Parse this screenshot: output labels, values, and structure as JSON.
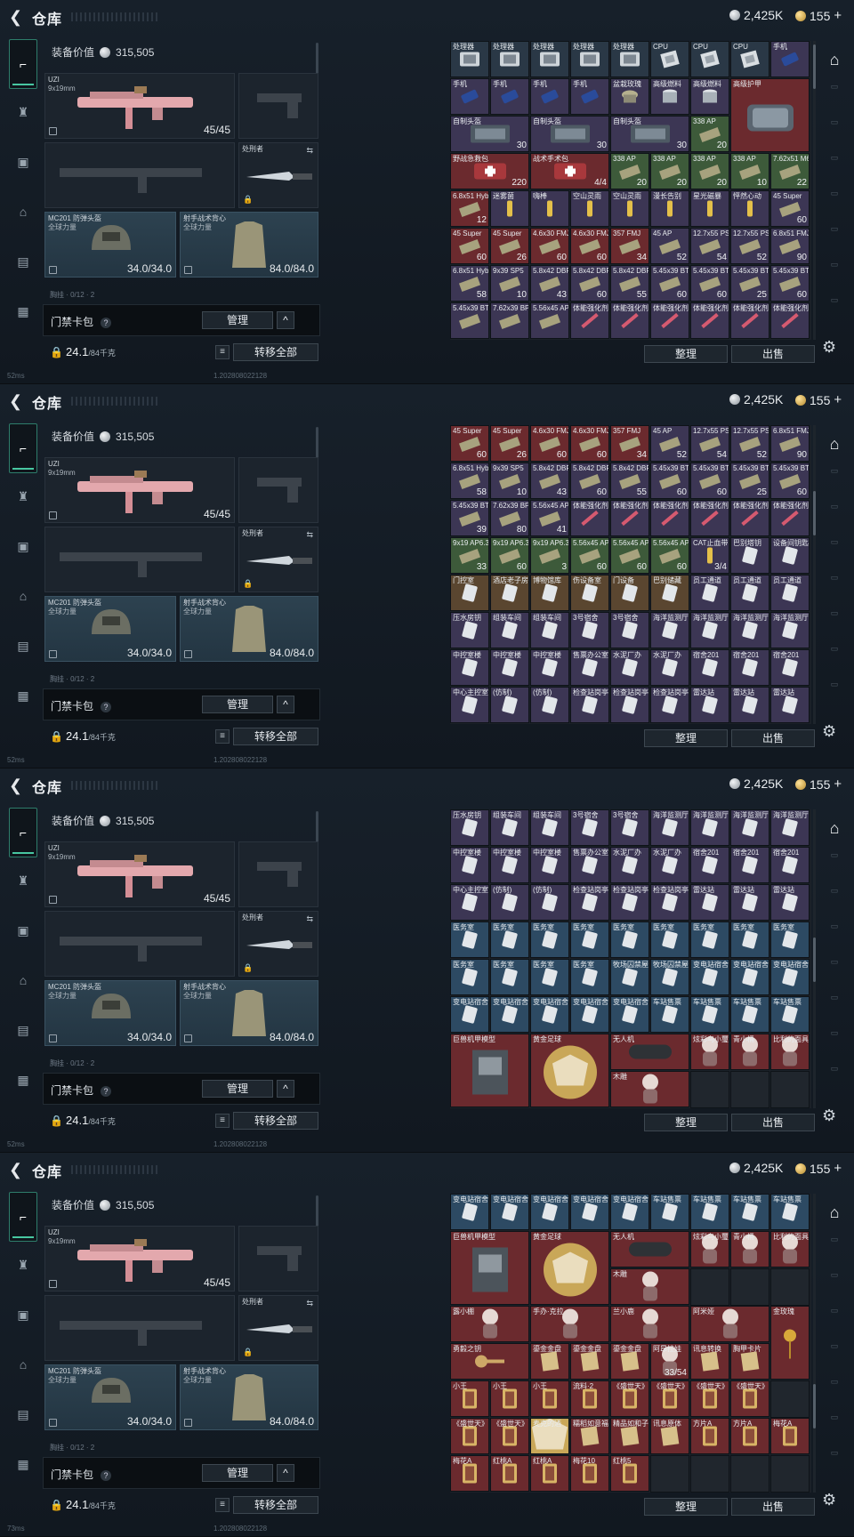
{
  "header": {
    "title": "仓库",
    "silver": "2,425K",
    "gold": "155",
    "plus": "+"
  },
  "loadout": {
    "equip_value_label": "装备价值",
    "equip_value": "315,505",
    "primary": {
      "name": "UZI",
      "caliber": "9x19mm",
      "ammo": "45/45"
    },
    "melee": {
      "name": "处刑者"
    },
    "helmet": {
      "name": "MC201 防弹头盔",
      "sub": "全球力量",
      "durability": "34.0/34.0"
    },
    "armor": {
      "name": "射手战术背心",
      "sub": "全球力量",
      "durability": "84.0/84.0"
    },
    "peek_text": "胸挂 · 0/12 · 2"
  },
  "keycard": {
    "label": "门禁卡包",
    "help": "?",
    "manage": "管理",
    "chevron": "^"
  },
  "footer": {
    "weight": "24.1",
    "weight_max": "/84千克",
    "transfer_all": "转移全部",
    "sort": "整理",
    "sell": "出售"
  },
  "status": {
    "ping_1": "52ms",
    "ping_4": "73ms",
    "build": "1.202808022128"
  },
  "colors": {
    "accent": "#48c7a1",
    "tile_brown": "#5a4630",
    "tile_blue": "#2d4a63",
    "tile_red": "#6b2a2e",
    "tile_purple": "#3c3654",
    "tile_green": "#3d5a3a"
  },
  "panels": [
    {
      "rows": [
        [
          "处理器|6|processor",
          "处理器|6|processor",
          "处理器|6|processor",
          "处理器|6|processor",
          "处理器|6|processor",
          "CPU|6|cpu",
          "CPU|6|cpu",
          "CPU|6|cpu",
          "手机|4|phone"
        ],
        [
          "手机|4|phone",
          "手机|4|phone",
          "手机|4|phone",
          "手机|4|phone",
          "盆栽玫瑰|4|pot",
          "高级燃料|4|can",
          "高级燃料|4|can",
          "高级护甲|3|armor",
          ""
        ],
        [
          "自制头盔|4|box",
          "",
          "自制头盔|4|box",
          "",
          "自制头盔|4|box",
          "",
          "338 AP|5|ammo",
          "",
          ""
        ],
        [
          "野战急救包|3|medkit",
          "",
          "战术手术包|3|medkit",
          "",
          "338 AP|5|ammo",
          "338 AP|5|ammo",
          "338 AP|5|ammo",
          "338 AP|5|ammo",
          "7.62x51 M61|5|ammo"
        ],
        [
          "6.8x51 Hybrid|3|ammo",
          "迷雾菌|4|tonic",
          "嗨棒|4|tonic",
          "空山灵雨|4|tonic",
          "空山灵雨|4|tonic",
          "漫长告别|4|tonic",
          "星光磁暴|4|tonic",
          "怦然心动|4|tonic",
          "45 Super|4|ammo"
        ],
        [
          "45 Super|3|ammo",
          "45 Super|3|ammo",
          "4.6x30 FMJ|3|ammo",
          "4.6x30 FMJ|3|ammo",
          "357 FMJ|3|ammo",
          "45 AP|4|ammo",
          "12.7x55 PS12|4|ammo",
          "12.7x55 PS12|4|ammo",
          "6.8x51 FMJ|4|ammo"
        ],
        [
          "6.8x51 Hybrid|4|ammo",
          "9x39 SP5|4|ammo",
          "5.8x42 DBP10|4|ammo",
          "5.8x42 DBP10|4|ammo",
          "5.8x42 DBP10|4|ammo",
          "5.45x39 BT|4|ammo",
          "5.45x39 BT|4|ammo",
          "5.45x39 BT|4|ammo",
          "5.45x39 BT|4|ammo"
        ],
        [
          "5.45x39 BT|4|ammo",
          "7.62x39 BP|4|ammo",
          "5.56x45 AP|4|ammo",
          "体能强化剂|4|syringe",
          "体能强化剂|4|syringe",
          "体能强化剂|4|syringe",
          "体能强化剂|4|syringe",
          "体能强化剂|4|syringe",
          "体能强化剂|4|syringe"
        ]
      ],
      "counts": [
        [
          "",
          "",
          "",
          "",
          "",
          "",
          "",
          "",
          ""
        ],
        [
          "",
          "",
          "",
          "",
          "",
          "",
          "",
          "",
          ""
        ],
        [
          "30",
          "",
          "30",
          "",
          "30",
          "",
          "20",
          "",
          "183"
        ],
        [
          "220",
          "",
          "4/4",
          "",
          "20",
          "20",
          "20",
          "10",
          "22"
        ],
        [
          "12",
          "",
          "",
          "",
          "",
          "",
          "",
          "",
          "60"
        ],
        [
          "60",
          "26",
          "60",
          "60",
          "34",
          "52",
          "54",
          "52",
          "90"
        ],
        [
          "58",
          "10",
          "43",
          "60",
          "55",
          "60",
          "60",
          "25",
          "60"
        ],
        [
          "",
          "",
          "",
          "",
          "",
          "",
          "",
          "",
          ""
        ]
      ]
    },
    {
      "rows": [
        [
          "45 Super|3|ammo",
          "45 Super|3|ammo",
          "4.6x30 FMJ|3|ammo",
          "4.6x30 FMJ|3|ammo",
          "357 FMJ|3|ammo",
          "45 AP|4|ammo",
          "12.7x55 PS12|4|ammo",
          "12.7x55 PS12|4|ammo",
          "6.8x51 FMJ|4|ammo"
        ],
        [
          "6.8x51 Hybrid|4|ammo",
          "9x39 SP5|4|ammo",
          "5.8x42 DBP10|4|ammo",
          "5.8x42 DBP10|4|ammo",
          "5.8x42 DBP10|4|ammo",
          "5.45x39 BT|4|ammo",
          "5.45x39 BT|4|ammo",
          "5.45x39 BT|4|ammo",
          "5.45x39 BT|4|ammo"
        ],
        [
          "5.45x39 BT|4|ammo",
          "7.62x39 BP|4|ammo",
          "5.56x45 AP|4|ammo",
          "体能强化剂|4|syringe",
          "体能强化剂|4|syringe",
          "体能强化剂|4|syringe",
          "体能强化剂|4|syringe",
          "体能强化剂|4|syringe",
          "体能强化剂|4|syringe"
        ],
        [
          "9x19 AP6.3|5|ammo",
          "9x19 AP6.3|5|ammo",
          "9x19 AP6.3|5|ammo",
          "5.56x45 AP|5|ammo",
          "5.56x45 AP|5|ammo",
          "5.56x45 AP|5|ammo",
          "CAT止血带|4|tonic",
          "巴别塔钥|4|keycard",
          "设备间钥匙|4|keycard"
        ],
        [
          "门控室|1|keycard",
          "酒店老子房|1|keycard",
          "博物馆库|1|keycard",
          "伤设备室|1|keycard",
          "门设备|1|keycard",
          "巴别储藏|1|keycard",
          "员工通道|4|keycard",
          "员工通道|4|keycard",
          "员工通道|4|keycard"
        ],
        [
          "压水房钥|4|keycard",
          "组装车间|4|keycard",
          "组装车间|4|keycard",
          "3号宿舍|4|keycard",
          "3号宿舍|4|keycard",
          "海洋监测厅|4|keycard",
          "海洋监测厅|4|keycard",
          "海洋监测厅|4|keycard",
          "海洋监测厅|4|keycard"
        ],
        [
          "中控室楼|4|keycard",
          "中控室楼|4|keycard",
          "中控室楼|4|keycard",
          "售票办公室|4|keycard",
          "水泥厂办|4|keycard",
          "水泥厂办|4|keycard",
          "宿舍201|4|keycard",
          "宿舍201|4|keycard",
          "宿舍201|4|keycard"
        ],
        [
          "中心主控室|4|keycard",
          "(仿制)|4|keycard",
          "(仿制)|4|keycard",
          "检查站岗亭|4|keycard",
          "检查站岗亭|4|keycard",
          "检查站岗亭|4|keycard",
          "雷达站|4|keycard",
          "雷达站|4|keycard",
          "雷达站|4|keycard"
        ]
      ],
      "counts": [
        [
          "60",
          "26",
          "60",
          "60",
          "34",
          "52",
          "54",
          "52",
          "90"
        ],
        [
          "58",
          "10",
          "43",
          "60",
          "55",
          "60",
          "60",
          "25",
          "60"
        ],
        [
          "39",
          "80",
          "41",
          "",
          "",
          "",
          "",
          "",
          ""
        ],
        [
          "33",
          "60",
          "3",
          "60",
          "60",
          "60",
          "3/4",
          "",
          ""
        ],
        [
          "",
          "",
          "",
          "",
          "",
          "",
          "",
          "",
          ""
        ],
        [
          "",
          "",
          "",
          "",
          "",
          "",
          "",
          "",
          ""
        ],
        [
          "",
          "",
          "",
          "",
          "",
          "",
          "",
          "",
          ""
        ],
        [
          "",
          "",
          "",
          "",
          "",
          "",
          "",
          "",
          ""
        ]
      ]
    },
    {
      "rows": [
        [
          "压水房钥|4|keycard",
          "组装车间|4|keycard",
          "组装车间|4|keycard",
          "3号宿舍|4|keycard",
          "3号宿舍|4|keycard",
          "海洋监测厅|4|keycard",
          "海洋监测厅|4|keycard",
          "海洋监测厅|4|keycard",
          "海洋监测厅|4|keycard"
        ],
        [
          "中控室楼|4|keycard",
          "中控室楼|4|keycard",
          "中控室楼|4|keycard",
          "售票办公室|4|keycard",
          "水泥厂办|4|keycard",
          "水泥厂办|4|keycard",
          "宿舍201|4|keycard",
          "宿舍201|4|keycard",
          "宿舍201|4|keycard"
        ],
        [
          "中心主控室|4|keycard",
          "(仿制)|4|keycard",
          "(仿制)|4|keycard",
          "检查站岗亭|4|keycard",
          "检查站岗亭|4|keycard",
          "检查站岗亭|4|keycard",
          "雷达站|4|keycard",
          "雷达站|4|keycard",
          "雷达站|4|keycard"
        ],
        [
          "医务室|2|keycard",
          "医务室|2|keycard",
          "医务室|2|keycard",
          "医务室|2|keycard",
          "医务室|2|keycard",
          "医务室|2|keycard",
          "医务室|2|keycard",
          "医务室|2|keycard",
          "医务室|2|keycard"
        ],
        [
          "医务室|2|keycard",
          "医务室|2|keycard",
          "医务室|2|keycard",
          "医务室|2|keycard",
          "牧场囚禁屋|2|keycard",
          "牧场囚禁屋|2|keycard",
          "变电站宿舍|2|keycard",
          "变电站宿舍|2|keycard",
          "变电站宿舍|2|keycard"
        ],
        [
          "变电站宿舍|2|keycard",
          "变电站宿舍|2|keycard",
          "变电站宿舍|2|keycard",
          "变电站宿舍|2|keycard",
          "变电站宿舍|2|keycard",
          "车站售票|2|keycard",
          "车站售票|2|keycard",
          "车站售票|2|keycard",
          "车站售票|2|keycard"
        ],
        [
          "巨兽机甲模型|3|mech",
          "",
          "黄金足球|3|ball",
          "",
          "无人机|3|drone",
          "",
          "炫彩乌小璽|3|figurine",
          "青小桶|3|figurine",
          "比利的面具|3|figurine"
        ],
        [
          "",
          "",
          "",
          "",
          "木雕|3|figurine",
          "",
          "",
          "",
          ""
        ]
      ],
      "counts": [
        [
          "",
          "",
          "",
          "",
          "",
          "",
          "",
          "",
          ""
        ],
        [
          "",
          "",
          "",
          "",
          "",
          "",
          "",
          "",
          ""
        ],
        [
          "",
          "",
          "",
          "",
          "",
          "",
          "",
          "",
          ""
        ],
        [
          "",
          "",
          "",
          "",
          "",
          "",
          "",
          "",
          ""
        ],
        [
          "",
          "",
          "",
          "",
          "",
          "",
          "",
          "",
          ""
        ],
        [
          "",
          "",
          "",
          "",
          "",
          "",
          "",
          "",
          ""
        ],
        [
          "",
          "",
          "",
          "",
          "",
          "",
          "",
          "",
          ""
        ],
        [
          "",
          "",
          "",
          "",
          "",
          "",
          "",
          "",
          ""
        ]
      ]
    },
    {
      "rows": [
        [
          "变电站宿舍|2|keycard",
          "变电站宿舍|2|keycard",
          "变电站宿舍|2|keycard",
          "变电站宿舍|2|keycard",
          "变电站宿舍|2|keycard",
          "车站售票|2|keycard",
          "车站售票|2|keycard",
          "车站售票|2|keycard",
          "车站售票|2|keycard"
        ],
        [
          "巨兽机甲模型|3|mech",
          "",
          "黄金足球|3|ball",
          "",
          "无人机|3|drone",
          "",
          "炫彩乌小璽|3|figurine",
          "青小桶|3|figurine",
          "比利的面具|3|figurine"
        ],
        [
          "",
          "",
          "",
          "",
          "木雕|3|figurine",
          "",
          "",
          "",
          ""
        ],
        [
          "露小棚|3|figurine",
          "",
          "手办·克拉|3|figurine",
          "",
          "兰小鹿|3|figurine",
          "",
          "阿米娅|3|figurine",
          "",
          "金玫瑰|3|rose"
        ],
        [
          "勇毅之钥|3|key",
          "",
          "鎏金金盘|3|paper",
          "鎏金金盘|3|paper",
          "鎏金金盘|3|paper",
          "阿昂拉娃|3|figurine",
          "讯息转换|3|paper",
          "胸甲卡片|3|paper",
          ""
        ],
        [
          "小王|3|card",
          "小王|3|card",
          "小王|3|card",
          "流料·2|3|card",
          "《盛世天》|3|card",
          "《盛世天》|3|card",
          "《盛世天》|3|card",
          "《盛世天》|3|card",
          ""
        ],
        [
          "《盛世天》|3|card",
          "《盛世天》|3|card",
          "麦克的酒|3|ball",
          "糯稻如意福|3|paper",
          "精品如和子|3|paper",
          "讯息原体|3|paper",
          "方片A|3|card",
          "方片A|3|card",
          "梅花A|3|card"
        ],
        [
          "梅花A|3|card",
          "红桃A|3|card",
          "红桃A|3|card",
          "梅花10|3|card",
          "红桃5|3|card",
          "",
          "",
          "",
          ""
        ]
      ],
      "counts": [
        [
          "",
          "",
          "",
          "",
          "",
          "",
          "",
          "",
          ""
        ],
        [
          "",
          "",
          "",
          "",
          "",
          "",
          "",
          "",
          ""
        ],
        [
          "",
          "",
          "",
          "",
          "",
          "",
          "",
          "",
          ""
        ],
        [
          "",
          "",
          "",
          "",
          "",
          "",
          "",
          "",
          ""
        ],
        [
          "",
          "",
          "",
          "",
          "",
          "33/54",
          "",
          "",
          ""
        ],
        [
          "",
          "",
          "",
          "",
          "",
          "",
          "",
          "",
          ""
        ],
        [
          "",
          "",
          "",
          "",
          "",
          "",
          "",
          "",
          ""
        ],
        [
          "",
          "",
          "",
          "",
          "",
          "",
          "",
          "",
          ""
        ]
      ]
    }
  ]
}
